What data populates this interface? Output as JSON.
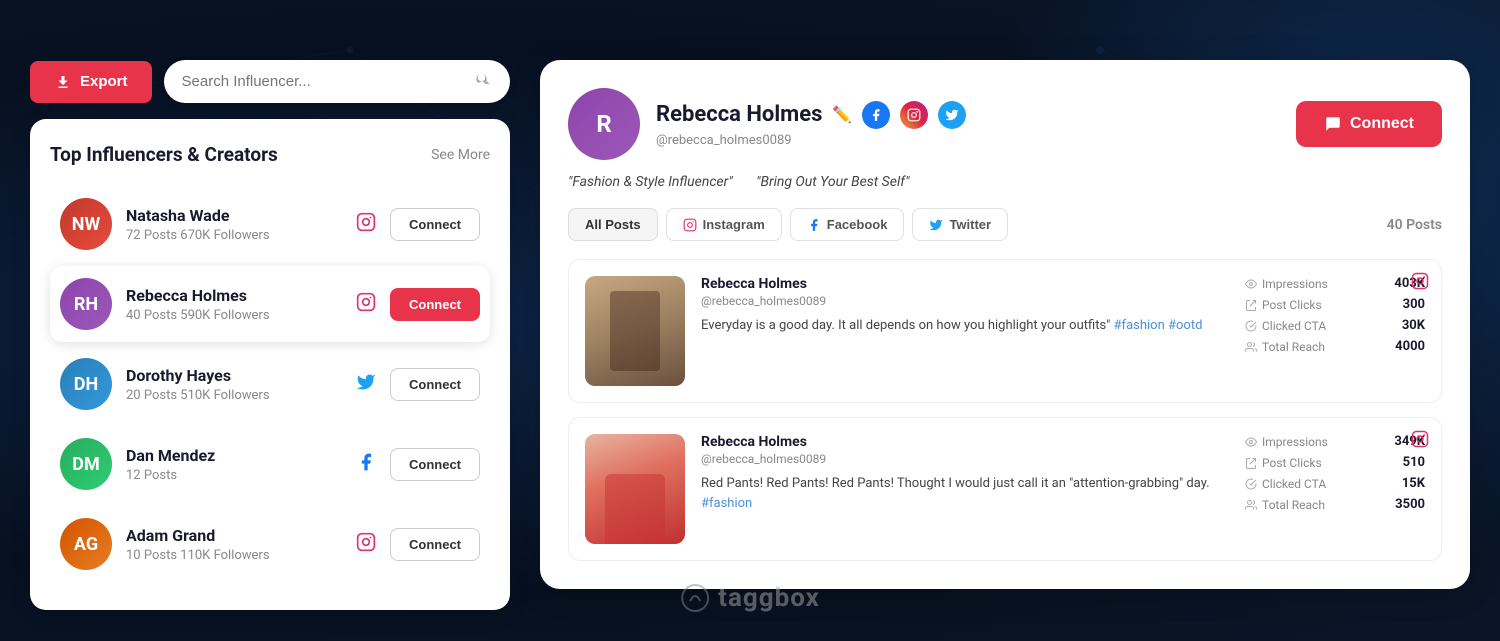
{
  "background": {
    "color": "#0a1628"
  },
  "toolbar": {
    "export_label": "Export",
    "search_placeholder": "Search Influencer..."
  },
  "influencer_list": {
    "title": "Top Influencers & Creators",
    "see_more_label": "See More",
    "items": [
      {
        "id": "natasha",
        "name": "Natasha Wade",
        "posts": "72 Posts",
        "followers": "670K Followers",
        "platform": "instagram",
        "connect_label": "Connect",
        "selected": false
      },
      {
        "id": "rebecca",
        "name": "Rebecca Holmes",
        "posts": "40 Posts",
        "followers": "590K Followers",
        "platform": "instagram",
        "connect_label": "Connect",
        "selected": true
      },
      {
        "id": "dorothy",
        "name": "Dorothy Hayes",
        "posts": "20 Posts",
        "followers": "510K Followers",
        "platform": "twitter",
        "connect_label": "Connect",
        "selected": false
      },
      {
        "id": "dan",
        "name": "Dan Mendez",
        "posts": "12 Posts",
        "followers": "",
        "platform": "facebook",
        "connect_label": "Connect",
        "selected": false
      },
      {
        "id": "adam",
        "name": "Adam Grand",
        "posts": "10 Posts",
        "followers": "110K Followers",
        "platform": "instagram",
        "connect_label": "Connect",
        "selected": false
      }
    ]
  },
  "profile": {
    "name": "Rebecca Holmes",
    "handle": "@rebecca_holmes0089",
    "bio_parts": [
      "\"Fashion & Style Influencer\"",
      "\"Bring Out Your Best Self\""
    ],
    "connect_label": "Connect",
    "posts_count": "40 Posts",
    "tabs": [
      {
        "id": "all",
        "label": "All Posts",
        "active": true
      },
      {
        "id": "instagram",
        "label": "Instagram",
        "platform": "instagram"
      },
      {
        "id": "facebook",
        "label": "Facebook",
        "platform": "facebook"
      },
      {
        "id": "twitter",
        "label": "Twitter",
        "platform": "twitter"
      }
    ],
    "posts": [
      {
        "author": "Rebecca Holmes",
        "handle": "@rebecca_holmes0089",
        "text": "Everyday is a good day. It all depends on how you highlight your outfits\"",
        "hashtags": "#fashion #ootd",
        "platform": "instagram",
        "metrics": [
          {
            "label": "Impressions",
            "value": "403K"
          },
          {
            "label": "Post Clicks",
            "value": "300"
          },
          {
            "label": "Clicked CTA",
            "value": "30K"
          },
          {
            "label": "Total Reach",
            "value": "4000"
          }
        ]
      },
      {
        "author": "Rebecca Holmes",
        "handle": "@rebecca_holmes0089",
        "text": "Red Pants! Red Pants! Red Pants! Thought I would just call it an \"attention-grabbing\" day.",
        "hashtags": "#fashion",
        "platform": "instagram",
        "metrics": [
          {
            "label": "Impressions",
            "value": "349K"
          },
          {
            "label": "Post Clicks",
            "value": "510"
          },
          {
            "label": "Clicked CTA",
            "value": "15K"
          },
          {
            "label": "Total Reach",
            "value": "3500"
          }
        ]
      }
    ]
  },
  "taggbox": {
    "logo_text": "taggbox"
  }
}
